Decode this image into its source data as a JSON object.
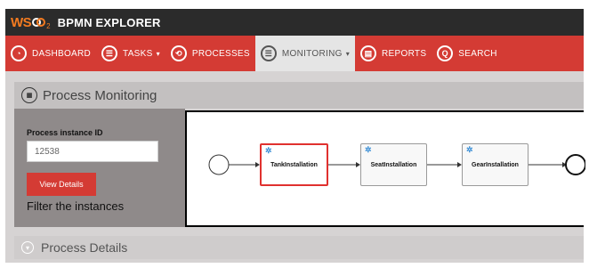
{
  "app": {
    "logo_text": "WSO2",
    "title": "BPMN EXPLORER"
  },
  "nav": {
    "items": [
      {
        "label": "DASHBOARD",
        "icon": "dashboard-icon",
        "dropdown": false,
        "active": false
      },
      {
        "label": "TASKS",
        "icon": "tasks-icon",
        "dropdown": true,
        "active": false
      },
      {
        "label": "PROCESSES",
        "icon": "processes-icon",
        "dropdown": false,
        "active": false
      },
      {
        "label": "MONITORING",
        "icon": "monitoring-icon",
        "dropdown": true,
        "active": true
      },
      {
        "label": "REPORTS",
        "icon": "reports-icon",
        "dropdown": false,
        "active": false
      },
      {
        "label": "SEARCH",
        "icon": "search-icon",
        "dropdown": false,
        "active": false
      }
    ]
  },
  "monitoring": {
    "title": "Process Monitoring",
    "process_instance_label": "Process instance ID",
    "process_instance_value": "12538",
    "view_button": "View Details",
    "filter_text": "Filter the instances"
  },
  "diagram": {
    "tasks": [
      {
        "label": "TankInstallation",
        "selected": true
      },
      {
        "label": "SeatInstallation",
        "selected": false
      },
      {
        "label": "GearInstallation",
        "selected": false
      }
    ]
  },
  "details": {
    "title": "Process Details"
  },
  "colors": {
    "accent": "#d43b34",
    "topbar": "#2b2b2b",
    "brand_orange": "#f47b20",
    "selected_border": "#e0312f",
    "gear_blue": "#3b8fd6"
  }
}
